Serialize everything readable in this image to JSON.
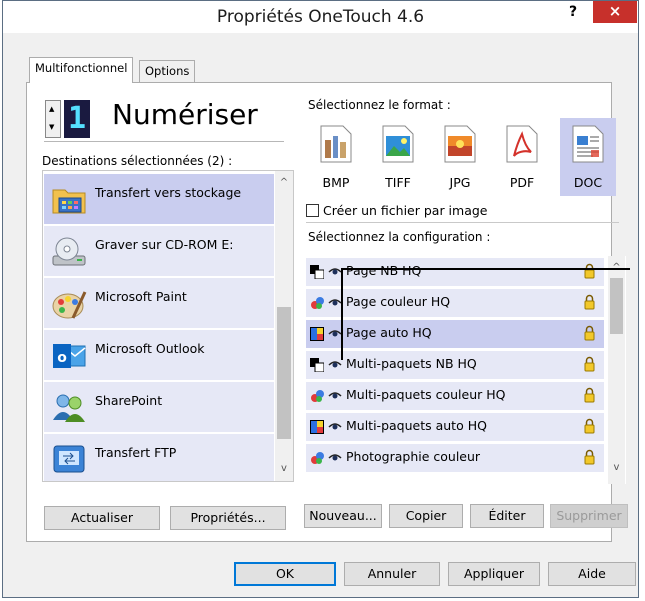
{
  "window": {
    "title": "Propriétés OneTouch 4.6",
    "help_label": "?",
    "close_label": "×"
  },
  "tabs": [
    {
      "label": "Multifonctionnel",
      "active": true
    },
    {
      "label": "Options",
      "active": false
    }
  ],
  "function_selector": {
    "digit": "1",
    "spin_up": "▲",
    "spin_down": "▼",
    "label": "Numériser"
  },
  "destinations": {
    "header": "Destinations sélectionnées (2) :",
    "items": [
      {
        "label": "Transfert vers stockage",
        "icon": "folder-storage-icon",
        "selected": true
      },
      {
        "label": "Graver sur CD-ROM  E:",
        "icon": "cd-drive-icon",
        "selected": false
      },
      {
        "label": "Microsoft Paint",
        "icon": "paint-palette-icon",
        "selected": false
      },
      {
        "label": "Microsoft Outlook",
        "icon": "outlook-icon",
        "selected": false
      },
      {
        "label": "SharePoint",
        "icon": "sharepoint-icon",
        "selected": false
      },
      {
        "label": "Transfert FTP",
        "icon": "ftp-icon",
        "selected": false
      }
    ],
    "scroll_up": "^",
    "scroll_down": "v"
  },
  "format": {
    "header": "Sélectionnez le format :",
    "items": [
      {
        "label": "BMP",
        "icon": "bmp-file-icon",
        "selected": false
      },
      {
        "label": "TIFF",
        "icon": "tiff-file-icon",
        "selected": false
      },
      {
        "label": "JPG",
        "icon": "jpg-file-icon",
        "selected": false
      },
      {
        "label": "PDF",
        "icon": "pdf-file-icon",
        "selected": false
      },
      {
        "label": "DOC",
        "icon": "doc-file-icon",
        "selected": true
      }
    ],
    "checkbox_label": "Créer un fichier par image",
    "checkbox_checked": false
  },
  "configuration": {
    "header": "Sélectionnez la configuration :",
    "items": [
      {
        "label": "Page NB HQ",
        "icon": "bw-page-icon",
        "selected": false
      },
      {
        "label": "Page couleur HQ",
        "icon": "color-page-icon",
        "selected": false
      },
      {
        "label": "Page auto HQ",
        "icon": "auto-page-icon",
        "selected": true
      },
      {
        "label": "Multi-paquets NB HQ",
        "icon": "bw-page-icon",
        "selected": false
      },
      {
        "label": "Multi-paquets couleur HQ",
        "icon": "color-page-icon",
        "selected": false
      },
      {
        "label": "Multi-paquets auto HQ",
        "icon": "auto-page-icon",
        "selected": false
      },
      {
        "label": "Photographie couleur",
        "icon": "color-page-icon",
        "selected": false
      }
    ],
    "scroll_up": "^",
    "scroll_down": "v"
  },
  "buttons": {
    "refresh": "Actualiser",
    "properties": "Propriétés...",
    "new": "Nouveau...",
    "copy": "Copier",
    "edit": "Éditer",
    "delete": "Supprimer",
    "ok": "OK",
    "cancel": "Annuler",
    "apply": "Appliquer",
    "help": "Aide"
  },
  "colors": {
    "selection": "#c9cdef",
    "item_background": "#e6e8f6",
    "close_button": "#c7302b",
    "default_button_border": "#0078d7"
  }
}
